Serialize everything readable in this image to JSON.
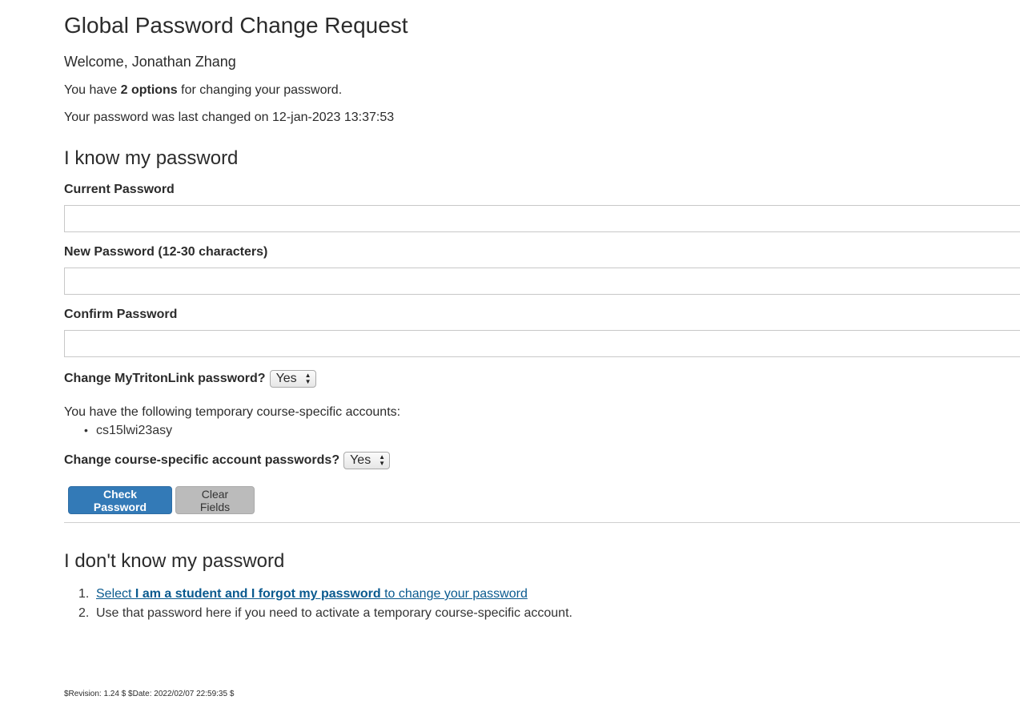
{
  "title": "Global Password Change Request",
  "welcome": "Welcome, Jonathan Zhang",
  "options_line": {
    "prefix": "You have ",
    "bold": "2 options",
    "suffix": " for changing your password."
  },
  "last_changed": "Your password was last changed on 12-jan-2023 13:37:53",
  "know_section": {
    "heading": "I know my password",
    "current_label": "Current Password",
    "current_value": "",
    "new_label": "New Password (12-30 characters)",
    "new_value": "",
    "confirm_label": "Confirm Password",
    "confirm_value": "",
    "mytritonlink_label": "Change MyTritonLink password?",
    "mytritonlink_value": "Yes",
    "temp_accounts_intro": "You have the following temporary course-specific accounts:",
    "temp_accounts": [
      "cs15lwi23asy"
    ],
    "course_label": "Change course-specific account passwords?",
    "course_value": "Yes",
    "check_button": "Check Password",
    "clear_button": "Clear Fields"
  },
  "dont_know_section": {
    "heading": "I don't know my password",
    "step1": {
      "num": "1.",
      "prefix": "Select ",
      "bold": "I am a student and I forgot my password",
      "suffix": " to change your password"
    },
    "step2": {
      "num": "2.",
      "text": "Use that password here if you need to activate a temporary course-specific account."
    }
  },
  "footer": "$Revision: 1.24 $ $Date: 2022/02/07 22:59:35 $",
  "colors": {
    "primary_button": "#337ab7",
    "clear_button": "#bbbbbb",
    "link": "#0a5a8f"
  },
  "icons": {
    "select_arrows": "updown-arrows-icon"
  }
}
